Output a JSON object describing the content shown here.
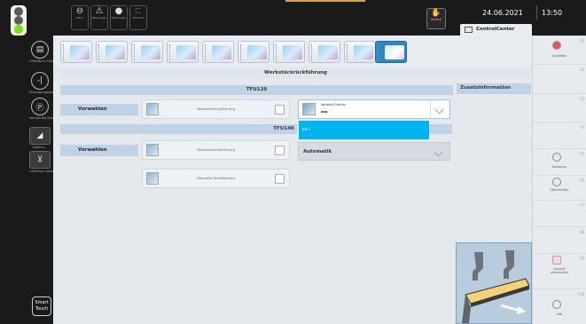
{
  "sidebar": {
    "items": [
      {
        "label": "Hilfe/Menü\nGlobal",
        "icon": "upload-tray-icon"
      },
      {
        "label": "Entsorgung/pos",
        "icon": "plus-minus-icon"
      },
      {
        "label": "Vollständig\nStanze",
        "icon": "parking-icon"
      },
      {
        "label": "Spalten...",
        "icon": "brush-icon"
      },
      {
        "label": "Luftkissen\nAnlage",
        "icon": "mixer-icon"
      }
    ],
    "touch_label": "Smart Touch"
  },
  "topbar": {
    "buttons": [
      {
        "label": "Fahrt",
        "icon": "minus-circle-icon"
      },
      {
        "label": "Warnungen",
        "icon": "warning-triangle-icon"
      },
      {
        "label": "Meldungen",
        "icon": "operator-icon"
      },
      {
        "label": "Aktionen",
        "icon": "layers-icon"
      }
    ],
    "back_label": "Zurück",
    "date": "24.06.2021",
    "time": "13:50",
    "control_center": "ControlCenter"
  },
  "main": {
    "section_title": "Werkstückrückführung",
    "additional_info": "Zusatzinformation",
    "tfu120": {
      "title": "TFU120",
      "preselect_label": "Vorwahlen",
      "option_label": "Werkstückrückführung",
      "dropdown_caption": "Verwahl Drehen",
      "dropdown_value": "aus",
      "dropdown_selected_item": "ein I"
    },
    "tfu140": {
      "title": "TFU140",
      "preselect_label": "Vorwahlen",
      "option_label": "Werkstückrückführung",
      "manual_option_label": "Manuelle Rückführung",
      "dropdown_value": "Automatik"
    }
  },
  "right_panel": {
    "items": [
      {
        "num": "F1",
        "label": "Schließen",
        "icon": "close-circle-icon"
      },
      {
        "num": "F2",
        "label": ""
      },
      {
        "num": "F3",
        "label": ""
      },
      {
        "num": "F4",
        "label": ""
      },
      {
        "num": "F5",
        "label": "Sensoren",
        "icon": "sensor-icon"
      },
      {
        "num": "F6",
        "label": "Übersichten",
        "icon": "overview-icon"
      },
      {
        "num": "F7",
        "label": ""
      },
      {
        "num": "F8",
        "label": ""
      },
      {
        "num": "F9",
        "label": "Ansicht\numschalten",
        "icon": "view-switch-icon"
      },
      {
        "num": "F10",
        "label": "Info",
        "icon": "info-icon"
      }
    ]
  },
  "colors": {
    "accent_blue": "#00b4f0",
    "header_band": "#bfd3e6",
    "status_green": "#7ddc2b",
    "active_tab": "#2f86c6"
  }
}
